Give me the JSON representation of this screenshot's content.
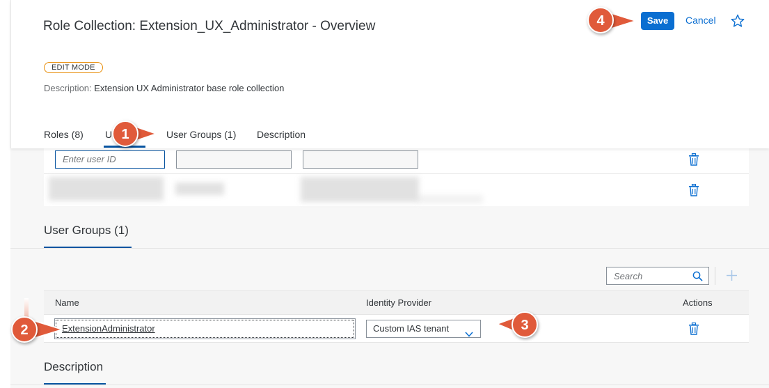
{
  "header": {
    "title": "Role Collection: Extension_UX_Administrator - Overview",
    "mode_badge": "EDIT MODE",
    "description_label": "Description:",
    "description_value": "Extension UX Administrator base role collection",
    "save_label": "Save",
    "cancel_label": "Cancel"
  },
  "tabs": [
    {
      "label": "Roles (8)"
    },
    {
      "label": "Us"
    },
    {
      "label": "User Groups (1)"
    },
    {
      "label": "Description"
    }
  ],
  "users": {
    "user_id_placeholder": "Enter user ID"
  },
  "user_groups": {
    "section_title": "User Groups (1)",
    "search_placeholder": "Search",
    "columns": {
      "name": "Name",
      "identity_provider": "Identity Provider",
      "actions": "Actions"
    },
    "row": {
      "name": "ExtensionAdministrator",
      "identity_provider": "Custom IAS tenant"
    }
  },
  "description_section": {
    "title": "Description"
  },
  "markers": [
    "1",
    "2",
    "3",
    "4"
  ],
  "colors": {
    "accent": "#0a6ed1",
    "tab_underline": "#0854a0",
    "badge_border": "#e78c07",
    "marker": "#e05a3a"
  }
}
